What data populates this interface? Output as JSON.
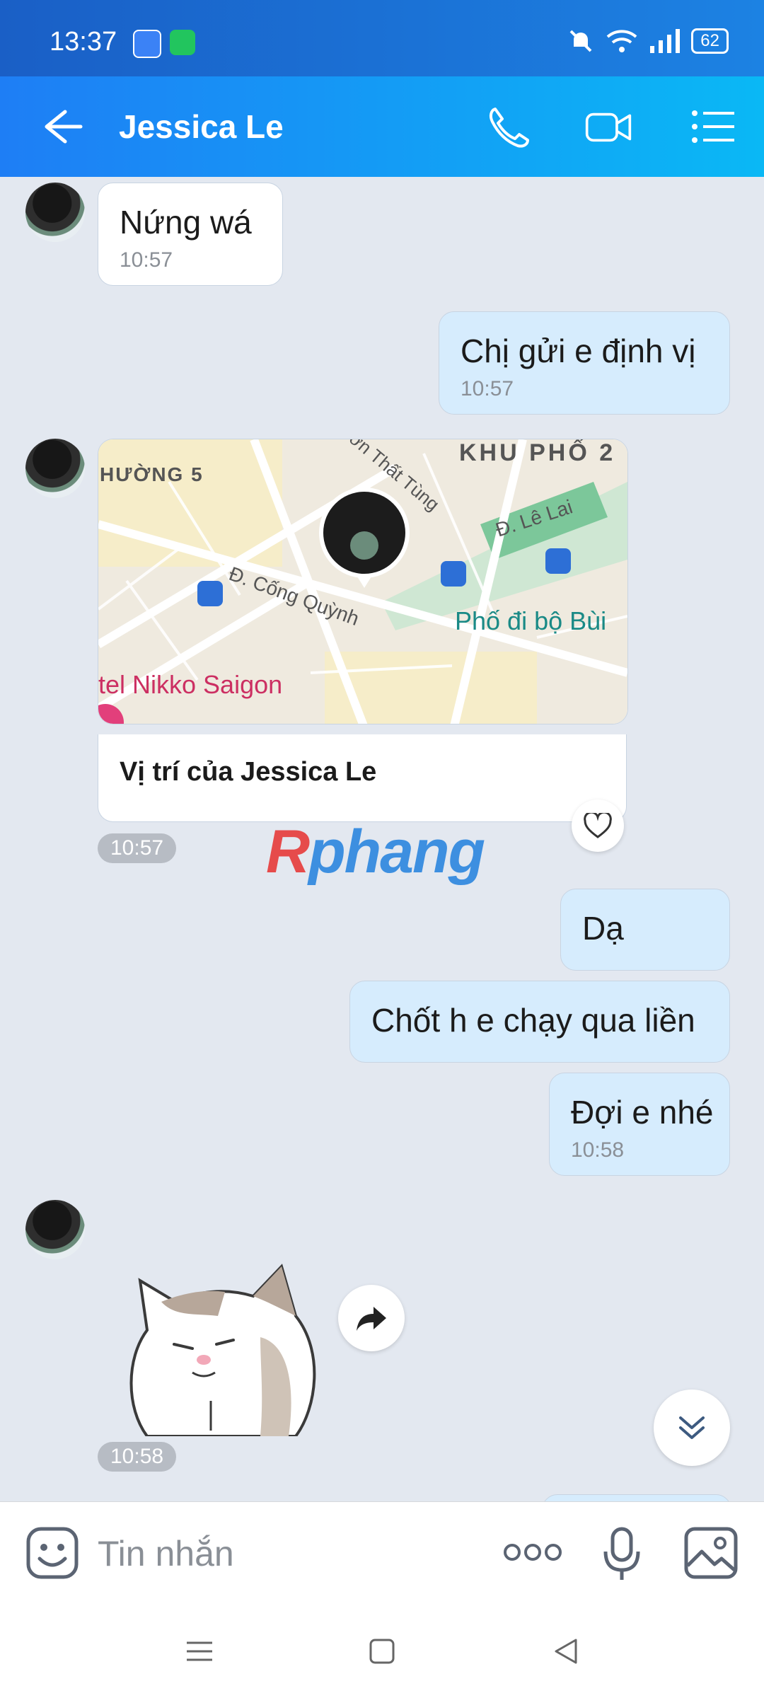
{
  "status": {
    "time": "13:37",
    "battery": "62"
  },
  "header": {
    "contact_name": "Jessica Le"
  },
  "messages": [
    {
      "text": "Nứng wá",
      "time": "10:57"
    },
    {
      "text": "Chị gửi e định vị",
      "time": "10:57"
    },
    {
      "location_caption": "Vị trí của Jessica Le",
      "time": "10:57"
    },
    {
      "text": "Dạ"
    },
    {
      "text": "Chốt h e chạy qua liền"
    },
    {
      "text": "Đợi e nhé",
      "time": "10:58"
    },
    {
      "time": "10:58"
    }
  ],
  "map_labels": {
    "ward": "HƯỜNG 5",
    "district": "KHU PHỐ 2",
    "street1": "Đ. Cống Quỳnh",
    "street2": "Đ. Lê Lai",
    "street3": "ơn Thất Tùng",
    "poi1": "Phố đi bộ Bùi",
    "poi2": "tel Nikko Saigon"
  },
  "watermark": {
    "part1": "R",
    "part2": "phang"
  },
  "input": {
    "placeholder": "Tin nhắn"
  },
  "colors": {
    "header_start": "#1e7ef5",
    "header_end": "#0ab8f5",
    "bubble_out": "#d6ecfd",
    "bubble_in": "#ffffff"
  }
}
